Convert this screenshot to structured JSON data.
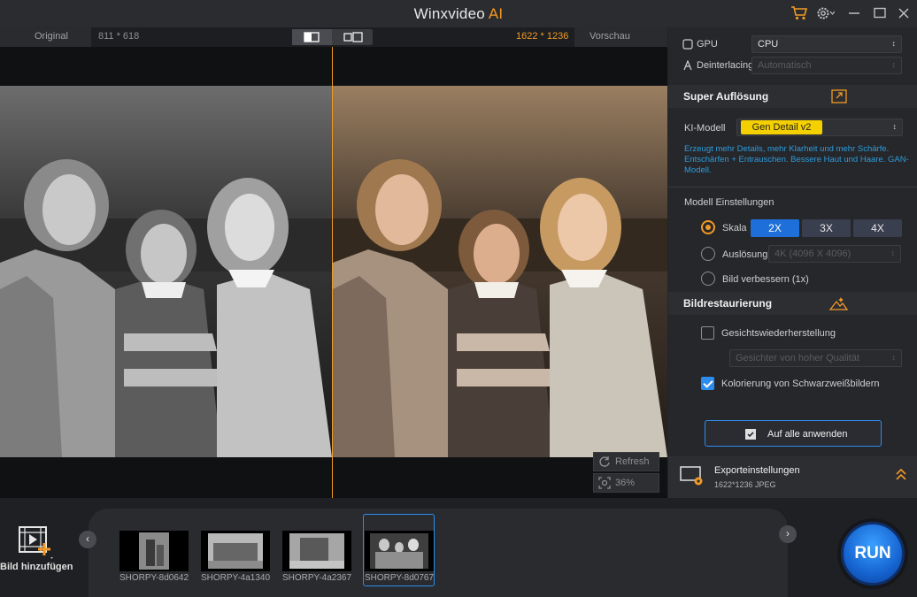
{
  "titlebar": {
    "name": "Winxvideo",
    "ai": "AI",
    "icons": [
      "cart-icon",
      "gear-icon",
      "minimize-icon",
      "maximize-icon",
      "close-icon"
    ],
    "accent": "#f29a24"
  },
  "preview": {
    "original_label": "Original",
    "original_size": "811 * 618",
    "output_size": "1622 * 1236",
    "preview_label": "Vorschau",
    "refresh_label": "Refresh",
    "zoom_label": "36%"
  },
  "panel": {
    "gpu_label": "GPU",
    "gpu_value": "CPU",
    "deinterlacing_label": "Deinterlacing",
    "deinterlacing_value": "Automatisch",
    "super_title": "Super Auflösung",
    "ki_label": "KI-Modell",
    "ki_value": "Gen Detail v2",
    "ki_desc": "Erzeugt mehr Details, mehr Klarheit und mehr Schärfe. Entschärfen + Entrauschen. Bessere Haut und Haare. GAN-Modell.",
    "model_settings": "Modell Einstellungen",
    "skala_label": "Skala",
    "scale_options": [
      "2X",
      "3X",
      "4X"
    ],
    "selected_scale": "2X",
    "aufloesung_label": "Auslösung",
    "aufloesung_value": "4K (4096 X 4096)",
    "bild_label": "Bild verbessern (1x)",
    "restore_title": "Bildrestaurierung",
    "face_label": "Gesichtswiederherstellung",
    "face_checked": false,
    "face_quality": "Gesichter von hoher Qualität",
    "color_label": "Kolorierung von Schwarzweißbildern",
    "color_checked": true,
    "apply_label": "Auf alle anwenden",
    "export_title": "Exporteinstellungen",
    "export_info": "1622*1236  JPEG"
  },
  "bottom": {
    "add_label": "Bild hinzufügen",
    "run_label": "RUN",
    "thumbs": [
      {
        "label": "SHORPY-8d0642",
        "selected": false
      },
      {
        "label": "SHORPY-4a1340",
        "selected": false
      },
      {
        "label": "SHORPY-4a2367",
        "selected": false
      },
      {
        "label": "SHORPY-8d0767",
        "selected": true
      }
    ]
  }
}
